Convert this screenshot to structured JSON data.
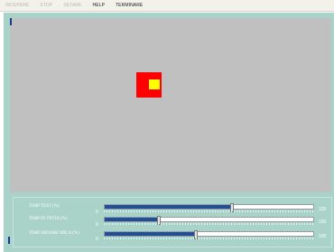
{
  "menu": {
    "items": [
      {
        "label": "INCEPERE",
        "enabled": false
      },
      {
        "label": "STOP",
        "enabled": false
      },
      {
        "label": "SETARE",
        "enabled": false
      },
      {
        "label": "HELP",
        "enabled": true
      },
      {
        "label": "TERMINARE",
        "enabled": true
      }
    ]
  },
  "colors": {
    "target_outer": "#ff0000",
    "target_inner": "#ffff00",
    "canvas": "#c0c0c0",
    "frame": "#a9d3c8",
    "progress_fill": "#1c4f9c"
  },
  "progress": {
    "rows": [
      {
        "label": "TIMP TEST (%)",
        "min": "0",
        "max": "100",
        "value_percent": 60
      },
      {
        "label": "TIMP IN TINTA (%)",
        "min": "0",
        "max": "100",
        "value_percent": 25
      },
      {
        "label": "TIMP SHOARE MICA (%)",
        "min": "0",
        "max": "100",
        "value_percent": 43
      }
    ]
  }
}
